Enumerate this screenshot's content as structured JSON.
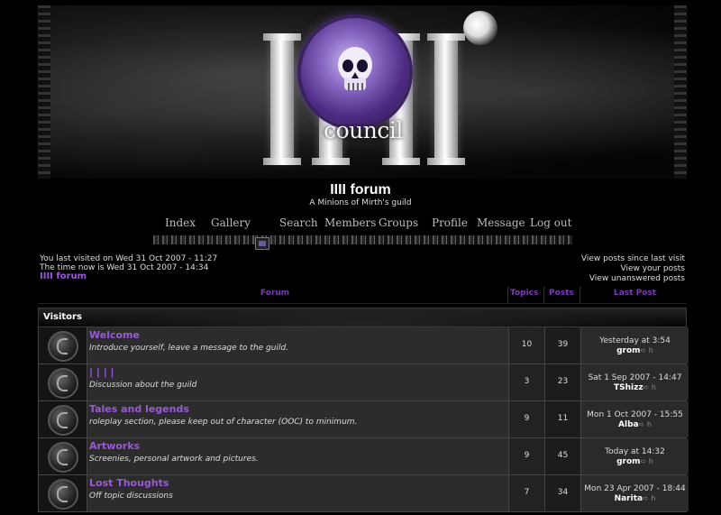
{
  "header": {
    "site_title": "IIII forum",
    "site_description": "A Minions of Mirth's guild",
    "logo_text": "council"
  },
  "nav": {
    "items": [
      "Index",
      "Gallery",
      "Search",
      "Members",
      "Groups",
      "Profile",
      "Message",
      "Log out"
    ]
  },
  "info": {
    "last_visit": "You last visited on Wed 31 Oct 2007 - 11:27",
    "time_now": "The time now is Wed 31 Oct 2007 - 14:34",
    "breadcrumb": "IIII forum",
    "links": [
      "View posts since last visit",
      "View your posts",
      "View unanswered posts"
    ]
  },
  "table": {
    "headers": {
      "forum": "Forum",
      "topics": "Topics",
      "posts": "Posts",
      "last_post": "Last Post"
    },
    "category": "Visitors",
    "forums": [
      {
        "name": "Welcome",
        "description": "Introduce yourself, leave a message to the guild.",
        "topics": "10",
        "posts": "39",
        "last_date": "Yesterday at 3:54",
        "last_user": "grom"
      },
      {
        "name": "| | | |",
        "description": "Discussion about the guild",
        "topics": "3",
        "posts": "23",
        "last_date": "Sat 1 Sep 2007 - 14:47",
        "last_user": "TShizz"
      },
      {
        "name": "Tales and legends",
        "description": "roleplay section, please keep out of character (OOC) to minimum.",
        "topics": "9",
        "posts": "11",
        "last_date": "Mon 1 Oct 2007 - 15:55",
        "last_user": "Alba"
      },
      {
        "name": "Artworks",
        "description": "Screenies, personal artwork and pictures.",
        "topics": "9",
        "posts": "45",
        "last_date": "Today at 14:32",
        "last_user": "grom"
      },
      {
        "name": "Lost Thoughts",
        "description": "Off topic discussions",
        "topics": "7",
        "posts": "34",
        "last_date": "Mon 23 Apr 2007 - 18:44",
        "last_user": "Narita"
      }
    ],
    "goto_glyph": "➪ h"
  },
  "colors": {
    "accent": "#9a5ad8",
    "header_text": "#7a3bb5",
    "background": "#000000"
  }
}
